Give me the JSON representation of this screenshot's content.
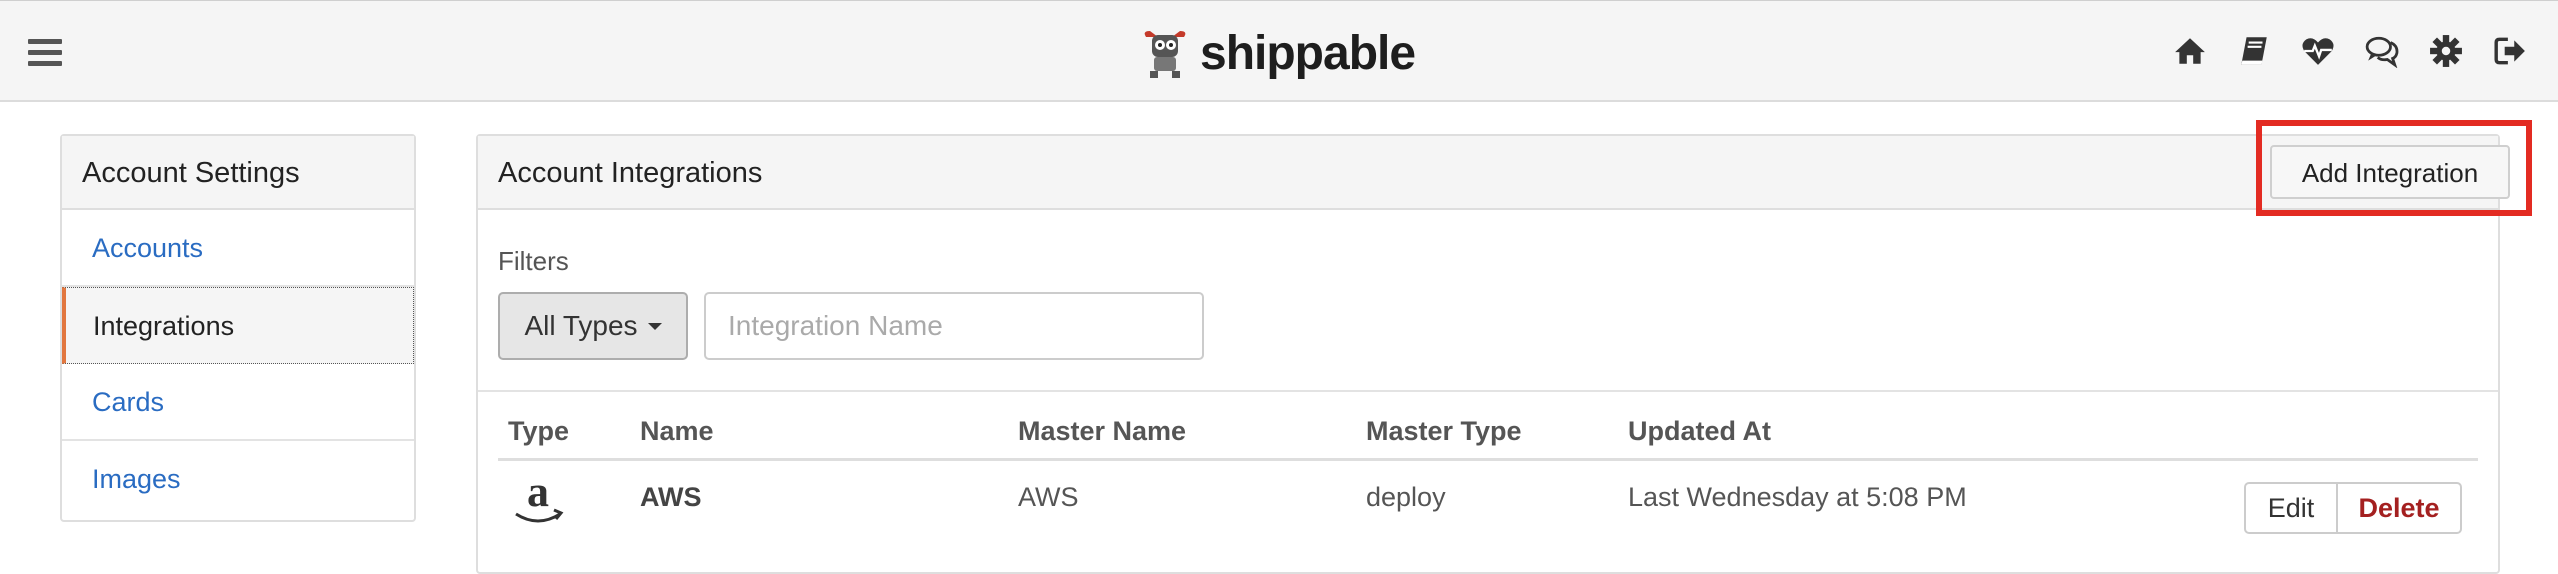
{
  "header": {
    "logo_text": "shippable",
    "nav_icons": [
      "home-icon",
      "book-icon",
      "heartbeat-icon",
      "chat-icon",
      "gear-icon",
      "logout-icon"
    ]
  },
  "sidebar": {
    "title": "Account Settings",
    "items": [
      {
        "label": "Accounts",
        "active": false
      },
      {
        "label": "Integrations",
        "active": true
      },
      {
        "label": "Cards",
        "active": false
      },
      {
        "label": "Images",
        "active": false
      }
    ]
  },
  "panel": {
    "title": "Account Integrations",
    "add_button": "Add Integration",
    "filters_label": "Filters",
    "type_filter": "All Types",
    "name_placeholder": "Integration Name",
    "columns": [
      "Type",
      "Name",
      "Master Name",
      "Master Type",
      "Updated At"
    ],
    "rows": [
      {
        "type_icon": "amazon-icon",
        "name": "AWS",
        "master_name": "AWS",
        "master_type": "deploy",
        "updated_at": "Last Wednesday at 5:08 PM",
        "edit_label": "Edit",
        "delete_label": "Delete"
      }
    ]
  },
  "colors": {
    "link": "#2a6cc2",
    "active_marker": "#e2773f",
    "highlight_box": "#e32b22",
    "delete_text": "#a42020"
  }
}
